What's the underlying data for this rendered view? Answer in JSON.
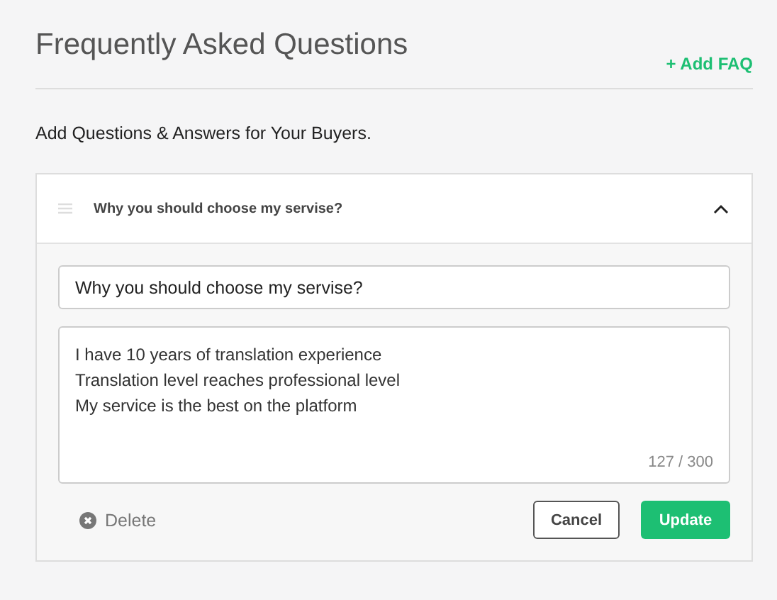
{
  "title": "Frequently Asked Questions",
  "add_button": "+ Add FAQ",
  "subtitle": "Add Questions & Answers for Your Buyers.",
  "faq": {
    "question": "Why you should choose my servise?",
    "expanded": true,
    "question_field": "Why you should choose my servise?",
    "answer_field": "I have 10 years of translation experience\nTranslation level reaches professional level\nMy service is the best on the platform",
    "counter": "127 / 300",
    "delete": "Delete",
    "cancel": "Cancel",
    "update": "Update"
  }
}
